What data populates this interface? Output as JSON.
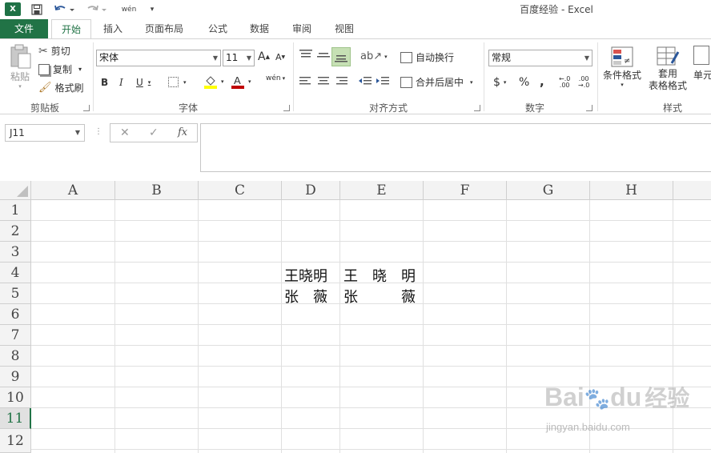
{
  "app": {
    "title": "百度经验 - Excel",
    "logo_text": "X"
  },
  "qat": {
    "more": "wén"
  },
  "tabs": [
    "文件",
    "开始",
    "插入",
    "页面布局",
    "公式",
    "数据",
    "审阅",
    "视图"
  ],
  "clipboard": {
    "paste": "粘贴",
    "cut": "剪切",
    "copy": "复制",
    "format_painter": "格式刷",
    "label": "剪贴板"
  },
  "font": {
    "name": "宋体",
    "size": "11",
    "bold": "B",
    "italic": "I",
    "underline": "U",
    "label": "字体",
    "grow": "A",
    "shrink": "A",
    "phonetic": "wén"
  },
  "alignment": {
    "wrap": "自动换行",
    "merge": "合并后居中",
    "label": "对齐方式"
  },
  "number": {
    "format": "常规",
    "currency": "$",
    "percent": "%",
    "comma": ",",
    "label": "数字",
    "inc": ".00",
    "dec": ".0"
  },
  "styles": {
    "conditional": "条件格式",
    "table1": "套用",
    "table2": "表格格式",
    "cell": "单元",
    "label": "样式"
  },
  "formula_bar": {
    "name_box": "J11",
    "fx": "fx",
    "value": ""
  },
  "columns": [
    "A",
    "B",
    "C",
    "D",
    "E",
    "F",
    "G",
    "H"
  ],
  "rows": [
    "1",
    "2",
    "3",
    "4",
    "5",
    "6",
    "7",
    "8",
    "9",
    "10",
    "11",
    "12"
  ],
  "cells": {
    "D4": "王晓明",
    "E4": "王　晓　明",
    "D5": "张　薇",
    "E5": "张　　　薇"
  },
  "watermark": {
    "brand": "Bai",
    "brand2": "du",
    "brand3": "经验",
    "url": "jingyan.baidu.com"
  },
  "colors": {
    "accent": "#217346",
    "file_tab": "#217346"
  }
}
